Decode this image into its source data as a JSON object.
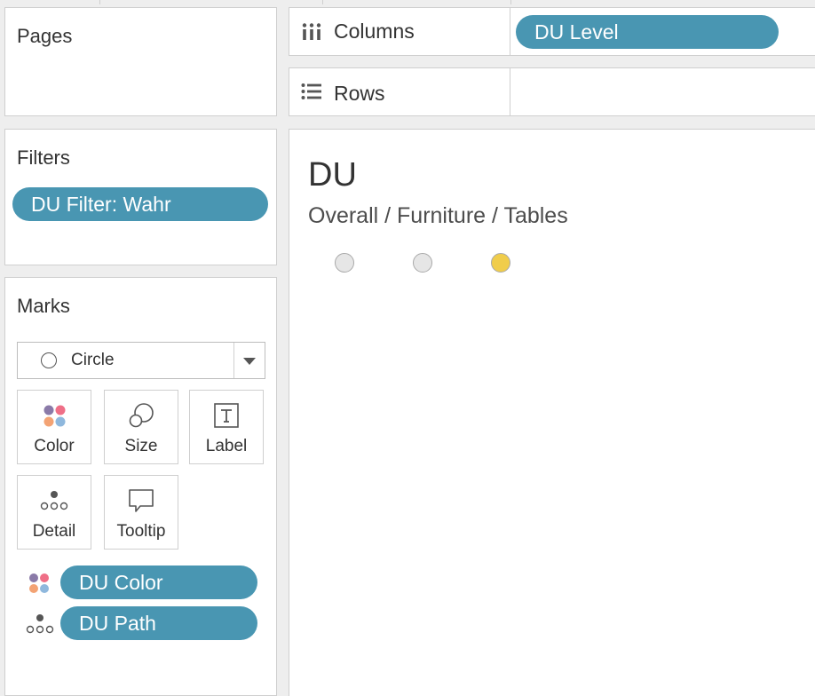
{
  "pages": {
    "title": "Pages"
  },
  "filters": {
    "title": "Filters",
    "pills": [
      "DU Filter: Wahr"
    ]
  },
  "marks": {
    "title": "Marks",
    "mark_type": "Circle",
    "buttons": {
      "color": "Color",
      "size": "Size",
      "label": "Label",
      "detail": "Detail",
      "tooltip": "Tooltip"
    },
    "fields": [
      {
        "icon": "color-dots-icon",
        "label": "DU Color"
      },
      {
        "icon": "detail-dots-icon",
        "label": "DU Path"
      }
    ]
  },
  "shelves": {
    "columns": {
      "label": "Columns",
      "pills": [
        "DU Level"
      ]
    },
    "rows": {
      "label": "Rows",
      "pills": []
    }
  },
  "view": {
    "title": "DU",
    "path": [
      "Overall",
      "Furniture",
      "Tables"
    ],
    "path_display": "Overall / Furniture / Tables",
    "marks": [
      {
        "level": "Overall",
        "color": "#e6e6e6"
      },
      {
        "level": "Furniture",
        "color": "#e6e6e6"
      },
      {
        "level": "Tables",
        "color": "#f0cd4b"
      }
    ]
  },
  "colors": {
    "pill": "#4996b2",
    "highlight": "#f0cd4b",
    "inactive": "#e6e6e6",
    "palette": [
      "#8a7aa8",
      "#ef6f87",
      "#f3a374",
      "#8fb8dd"
    ]
  }
}
